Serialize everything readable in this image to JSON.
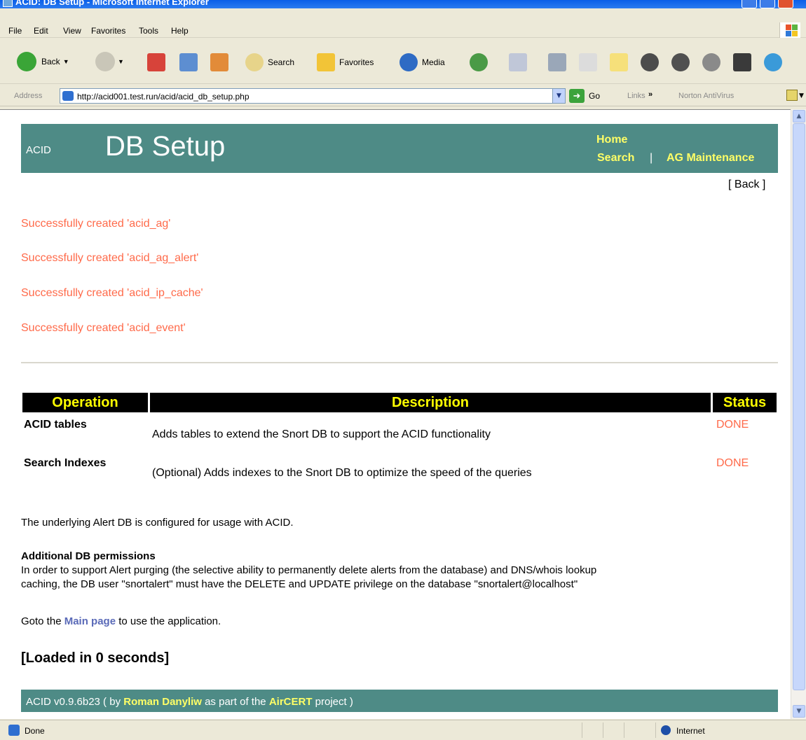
{
  "window": {
    "title": "ACID: DB Setup - Microsoft Internet Explorer"
  },
  "menu": [
    "File",
    "Edit",
    "View",
    "Favorites",
    "Tools",
    "Help"
  ],
  "toolbar": {
    "back": "Back",
    "search": "Search",
    "favorites": "Favorites",
    "media": "Media"
  },
  "address": {
    "label": "Address",
    "url": "http://acid001.test.run/acid/acid_db_setup.php",
    "go": "Go",
    "links": "Links",
    "more": "»",
    "norton": "Norton AntiVirus"
  },
  "page": {
    "brand": "ACID",
    "heading": "DB Setup",
    "nav": {
      "home": "Home",
      "search": "Search",
      "separator": "|",
      "ag_maintenance": "AG Maintenance"
    },
    "back": "[ Back ]",
    "messages": [
      "Successfully created 'acid_ag'",
      "Successfully created 'acid_ag_alert'",
      "Successfully created 'acid_ip_cache'",
      "Successfully created 'acid_event'"
    ],
    "table": {
      "headers": {
        "operation": "Operation",
        "description": "Description",
        "status": "Status"
      },
      "rows": [
        {
          "operation": "ACID tables",
          "description": "Adds tables to extend the Snort DB to support the ACID functionality",
          "status": "DONE"
        },
        {
          "operation": "Search Indexes",
          "description": "(Optional) Adds indexes to the Snort DB to optimize the speed of the queries",
          "status": "DONE"
        }
      ]
    },
    "configured_note": "The underlying Alert DB is configured for usage with ACID.",
    "permissions": {
      "title": "Additional DB permissions",
      "line1": "In order to support Alert purging (the selective ability to permanently delete alerts from the database) and DNS/whois lookup",
      "line2": "caching, the DB user \"snortalert\" must have the DELETE and UPDATE privilege on the database \"snortalert@localhost\""
    },
    "goto": {
      "prefix": "Goto the ",
      "link": "Main page",
      "suffix": " to use the application."
    },
    "loaded": "[Loaded in 0 seconds]",
    "footer": {
      "version": "ACID v0.9.6b23 ( by ",
      "author": "Roman Danyliw",
      "middle": " as part of the ",
      "project": "AirCERT",
      "suffix": " project )"
    }
  },
  "status": {
    "text": "Done",
    "zone": "Internet"
  },
  "colors": {
    "banner": "#4E8B86",
    "nav": "#FFFF66",
    "success": "#FF6A4A",
    "header_bg": "#000000",
    "header_text": "#FFFF00"
  }
}
